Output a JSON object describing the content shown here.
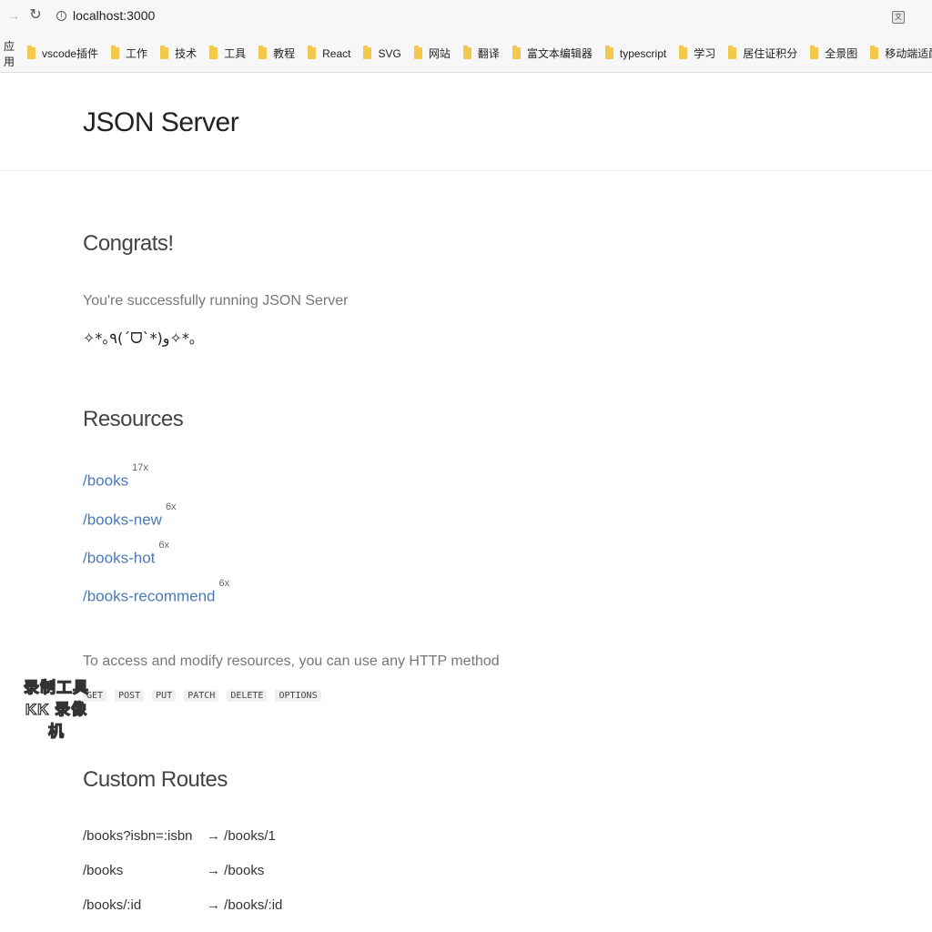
{
  "browser": {
    "url": "localhost:3000",
    "bookmarks_apps_label": "应用",
    "bookmarks": [
      "vscode插件",
      "工作",
      "技术",
      "工具",
      "教程",
      "React",
      "SVG",
      "网站",
      "翻译",
      "富文本编辑器",
      "typescript",
      "学习",
      "居住证积分",
      "全景图",
      "移动端适配方案"
    ]
  },
  "page": {
    "title": "JSON Server",
    "congrats_heading": "Congrats!",
    "success_message": "You're successfully running JSON Server",
    "kaomoji": "✧*｡٩(ˊᗜˋ*)و✧*｡",
    "resources_heading": "Resources",
    "resources": [
      {
        "path": "/books",
        "count": "17x"
      },
      {
        "path": "/books-new",
        "count": "6x"
      },
      {
        "path": "/books-hot",
        "count": "6x"
      },
      {
        "path": "/books-recommend",
        "count": "6x"
      }
    ],
    "access_text": "To access and modify resources, you can use any HTTP method",
    "methods": [
      "GET",
      "POST",
      "PUT",
      "PATCH",
      "DELETE",
      "OPTIONS"
    ],
    "custom_routes_heading": "Custom Routes",
    "routes": [
      {
        "from": "/books?isbn=:isbn",
        "to": "→ /books/1"
      },
      {
        "from": "/books",
        "to": "→ /books"
      },
      {
        "from": "/books/:id",
        "to": "→ /books/:id"
      }
    ]
  },
  "watermark": {
    "line1": "录制工具",
    "line2": "KK 录像机"
  }
}
